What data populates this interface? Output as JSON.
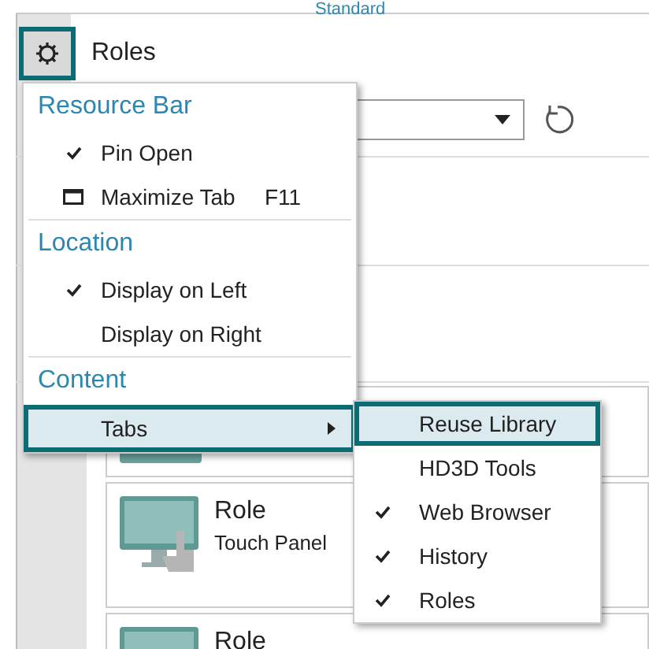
{
  "window": {
    "title": "Standard"
  },
  "panel": {
    "title": "Roles",
    "settings_selected": true
  },
  "roles": [
    {
      "kind": "hidden"
    },
    {
      "kind": "touch",
      "title": "Role",
      "subtitle": "Touch Panel"
    },
    {
      "kind": "touch",
      "title": "Role"
    }
  ],
  "menu": {
    "sections": [
      {
        "title": "Resource Bar",
        "items": [
          {
            "kind": "check",
            "label": "Pin Open",
            "checked": true
          },
          {
            "kind": "window",
            "label": "Maximize Tab",
            "shortcut": "F11"
          }
        ]
      },
      {
        "title": "Location",
        "items": [
          {
            "kind": "check",
            "label": "Display on Left",
            "checked": true
          },
          {
            "kind": "check",
            "label": "Display on Right",
            "checked": false
          }
        ]
      },
      {
        "title": "Content",
        "items": [
          {
            "kind": "submenu",
            "label": "Tabs",
            "selected": true,
            "expanded": true
          }
        ]
      }
    ]
  },
  "submenu": {
    "items": [
      {
        "label": "Reuse Library",
        "checked": false,
        "selected": true
      },
      {
        "label": "HD3D Tools",
        "checked": false,
        "selected": false
      },
      {
        "label": "Web Browser",
        "checked": true,
        "selected": false
      },
      {
        "label": "History",
        "checked": true,
        "selected": false
      },
      {
        "label": "Roles",
        "checked": true,
        "selected": false
      }
    ]
  }
}
